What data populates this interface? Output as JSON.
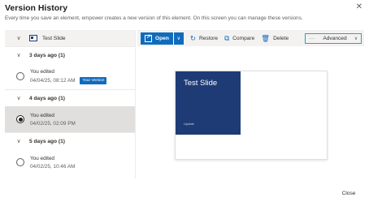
{
  "dialog": {
    "title": "Version History",
    "subtitle": "Every time you save an element, empower creates a new version of this element. On this screen you can manage these versions.",
    "close_icon": "✕",
    "close_button": "Close"
  },
  "file": {
    "name": "Test Slide",
    "icon": "slide-file-icon"
  },
  "groups": [
    {
      "label": "3 days ago (1)",
      "versions": [
        {
          "line1": "You edited",
          "date": "04/04/25, 08:12 AM",
          "badge": "Your Version",
          "selected": false
        }
      ]
    },
    {
      "label": "4 days ago (1)",
      "versions": [
        {
          "line1": "You edited",
          "date": "04/02/25, 02:09 PM",
          "badge": "",
          "selected": true
        }
      ]
    },
    {
      "label": "5 days ago (1)",
      "versions": [
        {
          "line1": "You edited",
          "date": "04/02/25, 10:46 AM",
          "badge": "",
          "selected": false
        }
      ]
    }
  ],
  "toolbar": {
    "open_label": "Open",
    "restore_label": "Restore",
    "compare_label": "Compare",
    "delete_label": "Delete",
    "advanced_label": "Advanced",
    "advanced_dots": "···"
  },
  "preview": {
    "slide_title": "Test Slide",
    "slide_subtitle": "Update"
  },
  "colors": {
    "accent": "#0f6cbd",
    "slide_panel": "#1f3b76",
    "highlight_border": "#27a3c7",
    "selected_row": "#e1dfdd"
  }
}
